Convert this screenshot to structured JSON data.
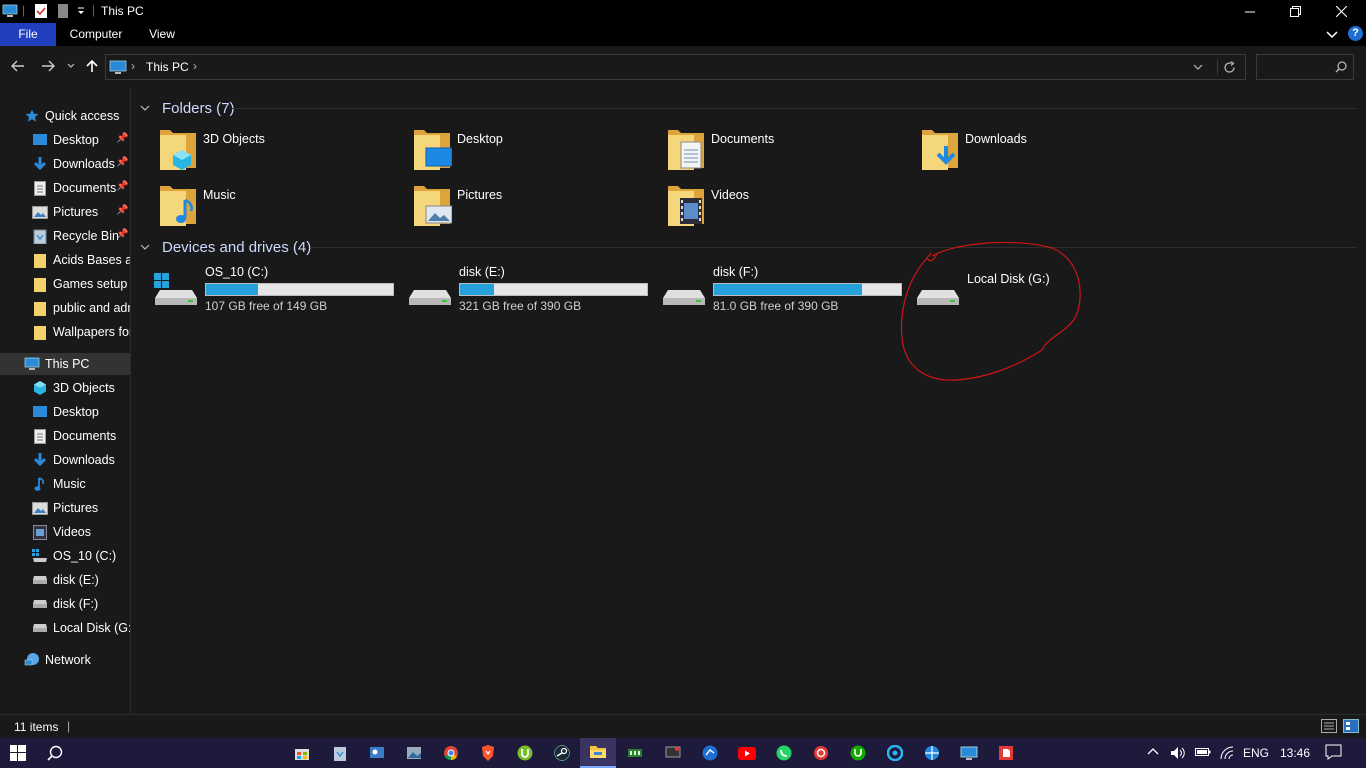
{
  "window": {
    "title": "This PC",
    "controls": {
      "minimize": "—",
      "restore": "❐",
      "close": "✕"
    }
  },
  "ribbon": {
    "tabs": [
      "File",
      "Computer",
      "View"
    ],
    "help": "?"
  },
  "address": {
    "path": "This PC",
    "separator": "›",
    "search_placeholder": ""
  },
  "sidebar": {
    "quick_access": {
      "label": "Quick access",
      "items": [
        {
          "label": "Desktop",
          "icon": "desktop-icon",
          "pinned": true
        },
        {
          "label": "Downloads",
          "icon": "downloads-icon",
          "pinned": true
        },
        {
          "label": "Documents",
          "icon": "documents-icon",
          "pinned": true
        },
        {
          "label": "Pictures",
          "icon": "pictures-icon",
          "pinned": true
        },
        {
          "label": "Recycle Bin",
          "icon": "recycle-bin-icon",
          "pinned": true
        },
        {
          "label": "Acids Bases an",
          "icon": "folder-icon",
          "pinned": false
        },
        {
          "label": "Games setup",
          "icon": "folder-icon",
          "pinned": false
        },
        {
          "label": "public and adr",
          "icon": "folder-icon",
          "pinned": false
        },
        {
          "label": "Wallpapers for",
          "icon": "folder-icon",
          "pinned": false
        }
      ]
    },
    "this_pc": {
      "label": "This PC",
      "items": [
        {
          "label": "3D Objects",
          "icon": "3d-objects-icon"
        },
        {
          "label": "Desktop",
          "icon": "desktop-icon"
        },
        {
          "label": "Documents",
          "icon": "documents-icon"
        },
        {
          "label": "Downloads",
          "icon": "downloads-icon"
        },
        {
          "label": "Music",
          "icon": "music-icon"
        },
        {
          "label": "Pictures",
          "icon": "pictures-icon"
        },
        {
          "label": "Videos",
          "icon": "videos-icon"
        },
        {
          "label": "OS_10 (C:)",
          "icon": "windows-drive-icon"
        },
        {
          "label": "disk (E:)",
          "icon": "drive-icon"
        },
        {
          "label": "disk (F:)",
          "icon": "drive-icon"
        },
        {
          "label": "Local Disk (G:)",
          "icon": "drive-icon"
        }
      ]
    },
    "network": {
      "label": "Network",
      "icon": "network-icon"
    }
  },
  "folders": {
    "heading": "Folders (7)",
    "items": [
      {
        "label": "3D Objects",
        "icon": "3d-objects-folder-icon"
      },
      {
        "label": "Desktop",
        "icon": "desktop-folder-icon"
      },
      {
        "label": "Documents",
        "icon": "documents-folder-icon"
      },
      {
        "label": "Downloads",
        "icon": "downloads-folder-icon"
      },
      {
        "label": "Music",
        "icon": "music-folder-icon"
      },
      {
        "label": "Pictures",
        "icon": "pictures-folder-icon"
      },
      {
        "label": "Videos",
        "icon": "videos-folder-icon"
      }
    ]
  },
  "drives": {
    "heading": "Devices and drives (4)",
    "items": [
      {
        "name": "OS_10 (C:)",
        "free": "107 GB free of 149 GB",
        "used_fraction": 0.28,
        "icon": "windows-drive-icon"
      },
      {
        "name": "disk (E:)",
        "free": "321 GB free of 390 GB",
        "used_fraction": 0.18,
        "icon": "drive-icon"
      },
      {
        "name": "disk (F:)",
        "free": "81.0 GB free of 390 GB",
        "used_fraction": 0.79,
        "icon": "drive-icon"
      },
      {
        "name": "Local Disk (G:)",
        "free": "",
        "used_fraction": null,
        "icon": "drive-icon"
      }
    ]
  },
  "status": {
    "items_count": "11 items"
  },
  "taskbar": {
    "language": "ENG",
    "time": "13:46"
  },
  "colors": {
    "accent": "#26a0da",
    "file_tab": "#1f3fbf",
    "background": "#191919",
    "taskbar": "#1e1a3c",
    "annotation": "#d01515"
  }
}
